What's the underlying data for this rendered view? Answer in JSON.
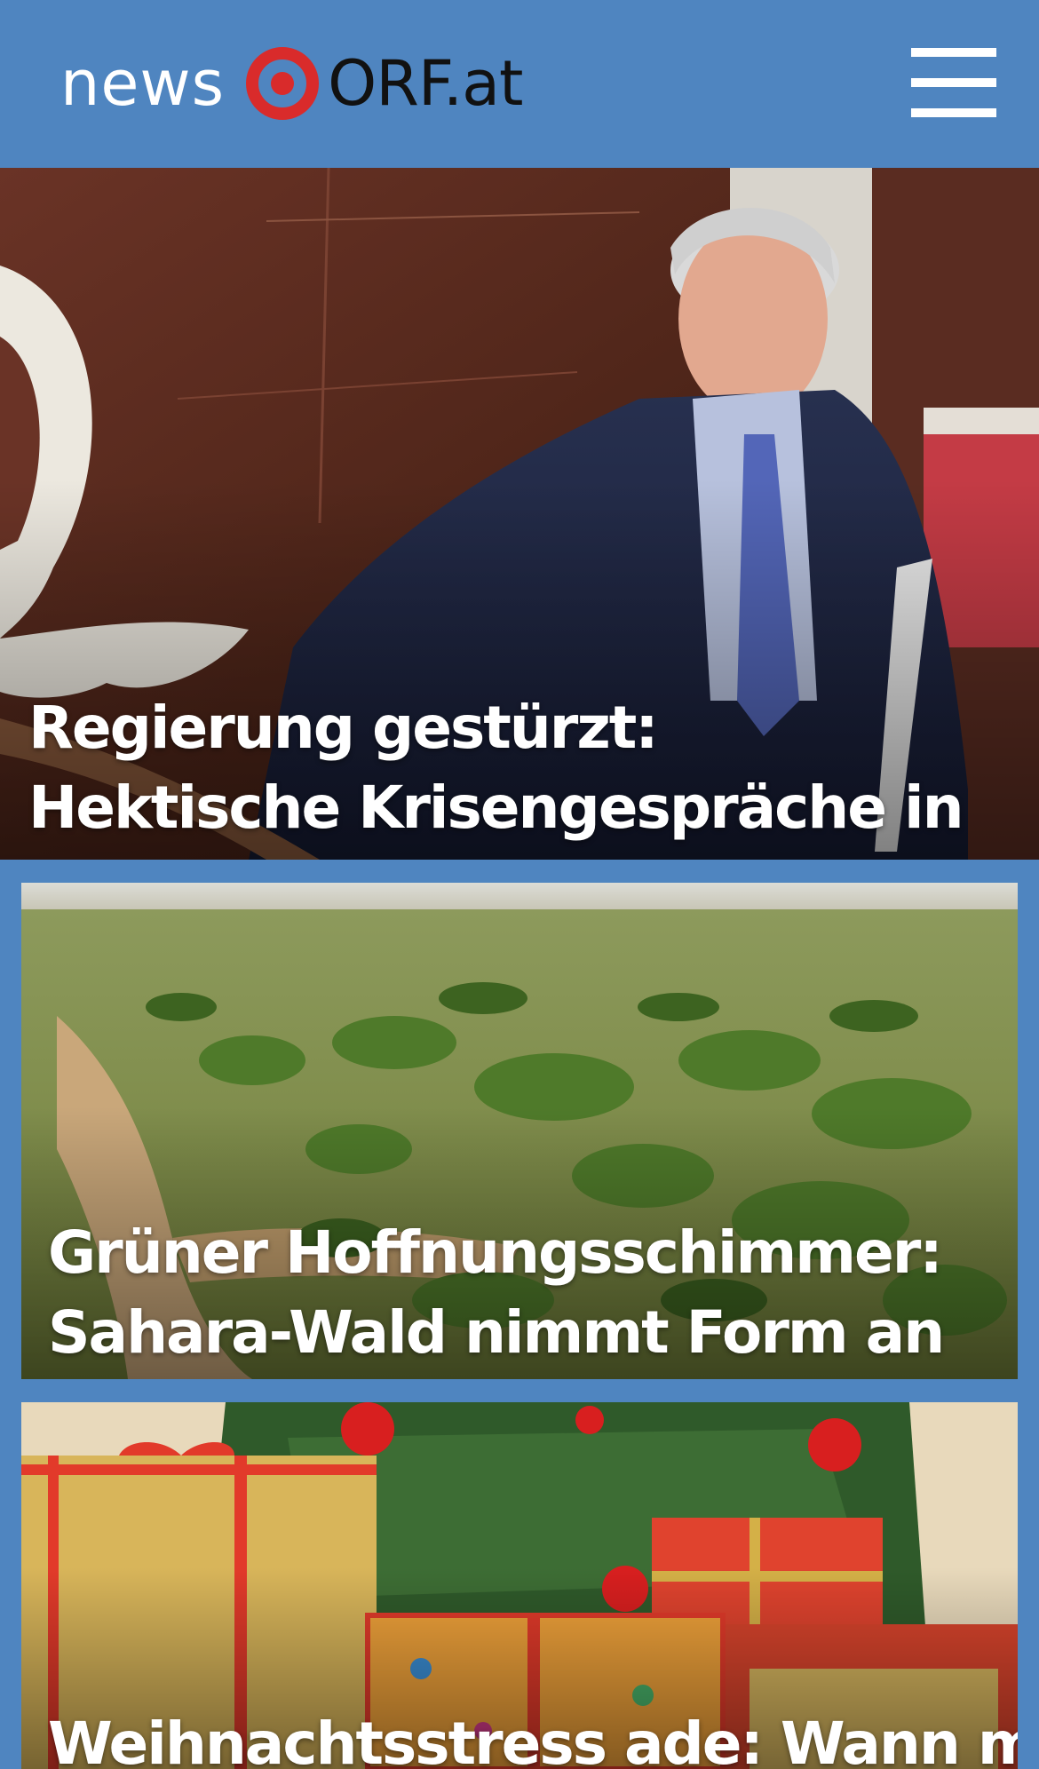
{
  "header": {
    "brand_left": "news",
    "brand_right": "ORF.at",
    "logo_icon": "orf-eye-logo-icon",
    "menu_icon": "hamburger-menu-icon"
  },
  "stories": [
    {
      "headline": "Regierung gestürzt: Hektische Krisengespräche in Paris",
      "image": "politician-in-parliament-photo"
    },
    {
      "headline": "Grüner Hoffnungsschimmer: Sahara-Wald nimmt Form an",
      "image": "sahel-savanna-aerial-photo"
    },
    {
      "headline": "Weihnachtsstress ade: Wann man",
      "image": "christmas-presents-tree-photo"
    }
  ],
  "colors": {
    "header_bg": "#4f85c0",
    "logo_red": "#d92b2b",
    "headline_text": "#ffffff"
  }
}
